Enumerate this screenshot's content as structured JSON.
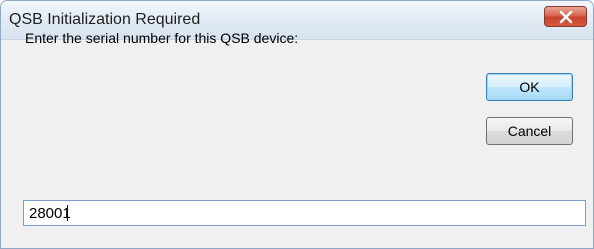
{
  "window": {
    "title": "QSB Initialization Required",
    "close_icon": "close-icon"
  },
  "dialog": {
    "prompt": "Enter the serial number for this QSB device:",
    "ok_label": "OK",
    "cancel_label": "Cancel",
    "serial_value": "28001"
  },
  "colors": {
    "title_bar": "#dce7f3",
    "close_button": "#d9604a",
    "ok_border": "#3c7fb1",
    "background": "#f0f0f0"
  }
}
